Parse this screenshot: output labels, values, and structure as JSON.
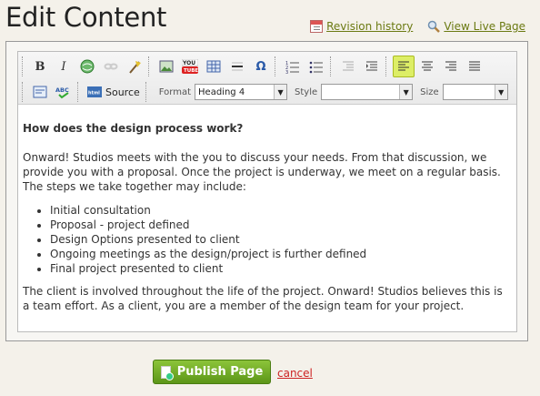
{
  "header": {
    "title": "Edit Content",
    "revision_history": "Revision history",
    "view_live": "View Live Page"
  },
  "toolbar": {
    "source_label": "Source",
    "format_label": "Format",
    "format_value": "Heading 4",
    "style_label": "Style",
    "style_value": "",
    "size_label": "Size",
    "size_value": "",
    "bold": "B",
    "italic": "I",
    "omega": "Ω"
  },
  "content": {
    "heading": "How does the design process work?",
    "intro": "Onward! Studios meets with the you to discuss your needs. From that discussion, we provide you with a proposal. Once the project is underway, we meet on a regular basis. The steps we take together may include:",
    "steps": [
      "Initial consultation",
      "Proposal - project defined",
      "Design Options presented to client",
      "Ongoing meetings as the design/project is further defined",
      "Final project presented to client"
    ],
    "closing": "The client is involved throughout the life of the project. Onward! Studios believes this is a team effort. As a client, you are a member of the design team for your project."
  },
  "actions": {
    "publish": "Publish Page",
    "cancel": "cancel"
  },
  "colors": {
    "publish_green": "#6aa325",
    "link_olive": "#6b7a12",
    "cancel_red": "#cc2222",
    "active_button": "#ddee66"
  }
}
